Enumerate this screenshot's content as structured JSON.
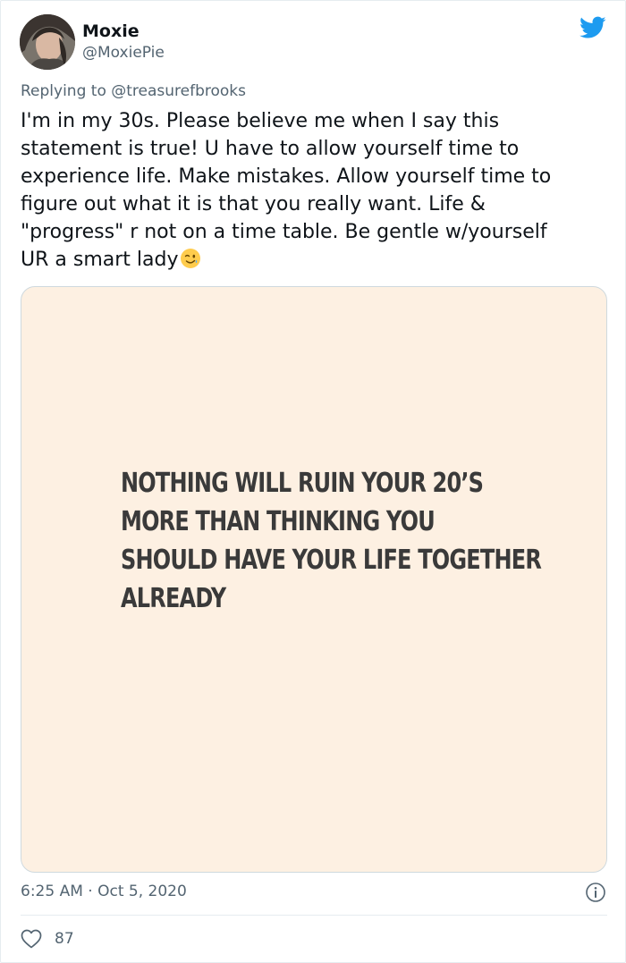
{
  "tweet": {
    "author": {
      "name": "Moxie",
      "handle": "@MoxiePie"
    },
    "reply_to": "Replying to @treasurefbrooks",
    "text_lines": [
      "I'm in my 30s. Please believe me when I say this",
      "statement is true! U have to allow yourself time to",
      "experience life. Make mistakes. Allow yourself time to",
      "figure out what it is that you really want. Life &",
      "\"progress\" r not on a time table. Be gentle w/yourself",
      "UR a smart lady"
    ],
    "emoji": "winking-face",
    "media": {
      "quote_lines": [
        "NOTHING WILL RUIN YOUR 20’S",
        "MORE THAN THINKING YOU",
        "SHOULD HAVE YOUR LIFE TOGETHER",
        "ALREADY"
      ],
      "background_color": "#fdf0e2"
    },
    "timestamp": "6:25 AM · Oct 5, 2020",
    "likes": "87"
  },
  "colors": {
    "twitter_blue": "#1d9bf0",
    "secondary_text": "#536471",
    "primary_text": "#0f1419"
  },
  "icons": [
    "twitter-bird-icon",
    "info-icon",
    "heart-icon",
    "winking-face-emoji"
  ]
}
